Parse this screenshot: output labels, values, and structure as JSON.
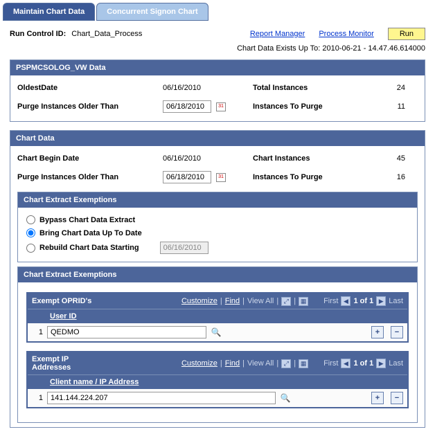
{
  "tabs": {
    "active": "Maintain Chart Data",
    "inactive": "Concurrent Signon Chart"
  },
  "run": {
    "label": "Run Control ID:",
    "value": "Chart_Data_Process",
    "report_manager": "Report Manager",
    "process_monitor": "Process Monitor",
    "run_btn": "Run"
  },
  "status_line": "Chart Data Exists Up To: 2010-06-21 - 14.47.46.614000",
  "psp": {
    "title": "PSPMCSOLOG_VW Data",
    "oldest_lbl": "OldestDate",
    "oldest_val": "06/16/2010",
    "total_lbl": "Total Instances",
    "total_val": "24",
    "purge_lbl": "Purge Instances Older Than",
    "purge_val": "06/18/2010",
    "topurge_lbl": "Instances To Purge",
    "topurge_val": "11"
  },
  "chart": {
    "title": "Chart Data",
    "begin_lbl": "Chart Begin Date",
    "begin_val": "06/16/2010",
    "inst_lbl": "Chart Instances",
    "inst_val": "45",
    "purge_lbl": "Purge Instances Older Than",
    "purge_val": "06/18/2010",
    "topurge_lbl": "Instances To Purge",
    "topurge_val": "16"
  },
  "ex1": {
    "title": "Chart Extract Exemptions",
    "r1": "Bypass Chart Data Extract",
    "r2": "Bring Chart Data Up To Date",
    "r3": "Rebuild Chart Data Starting",
    "date": "06/16/2010"
  },
  "ex2": {
    "title": "Chart Extract Exemptions"
  },
  "grid1": {
    "title": "Exempt OPRID's",
    "customize": "Customize",
    "find": "Find",
    "viewall": "View All",
    "first": "First",
    "count": "1 of 1",
    "last": "Last",
    "col": "User ID",
    "rownum": "1",
    "value": "QEDMO"
  },
  "grid2": {
    "title": "Exempt IP Addresses",
    "customize": "Customize",
    "find": "Find",
    "viewall": "View All",
    "first": "First",
    "count": "1 of 1",
    "last": "Last",
    "col": "Client name / IP Address",
    "rownum": "1",
    "value": "141.144.224.207"
  }
}
